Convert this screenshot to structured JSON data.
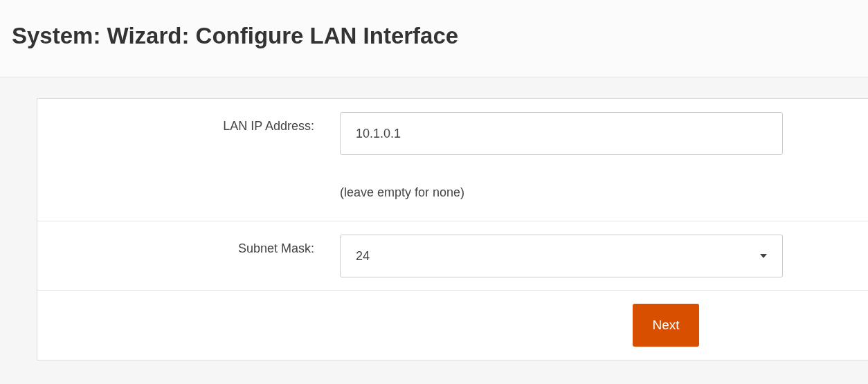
{
  "page_title": "System: Wizard: Configure LAN Interface",
  "fields": [
    {
      "kind": "text",
      "label": "LAN IP Address:",
      "value": "10.1.0.1",
      "hint": "(leave empty for none)"
    },
    {
      "kind": "select",
      "label": "Subnet Mask:",
      "value": "24"
    }
  ],
  "button": "Next"
}
